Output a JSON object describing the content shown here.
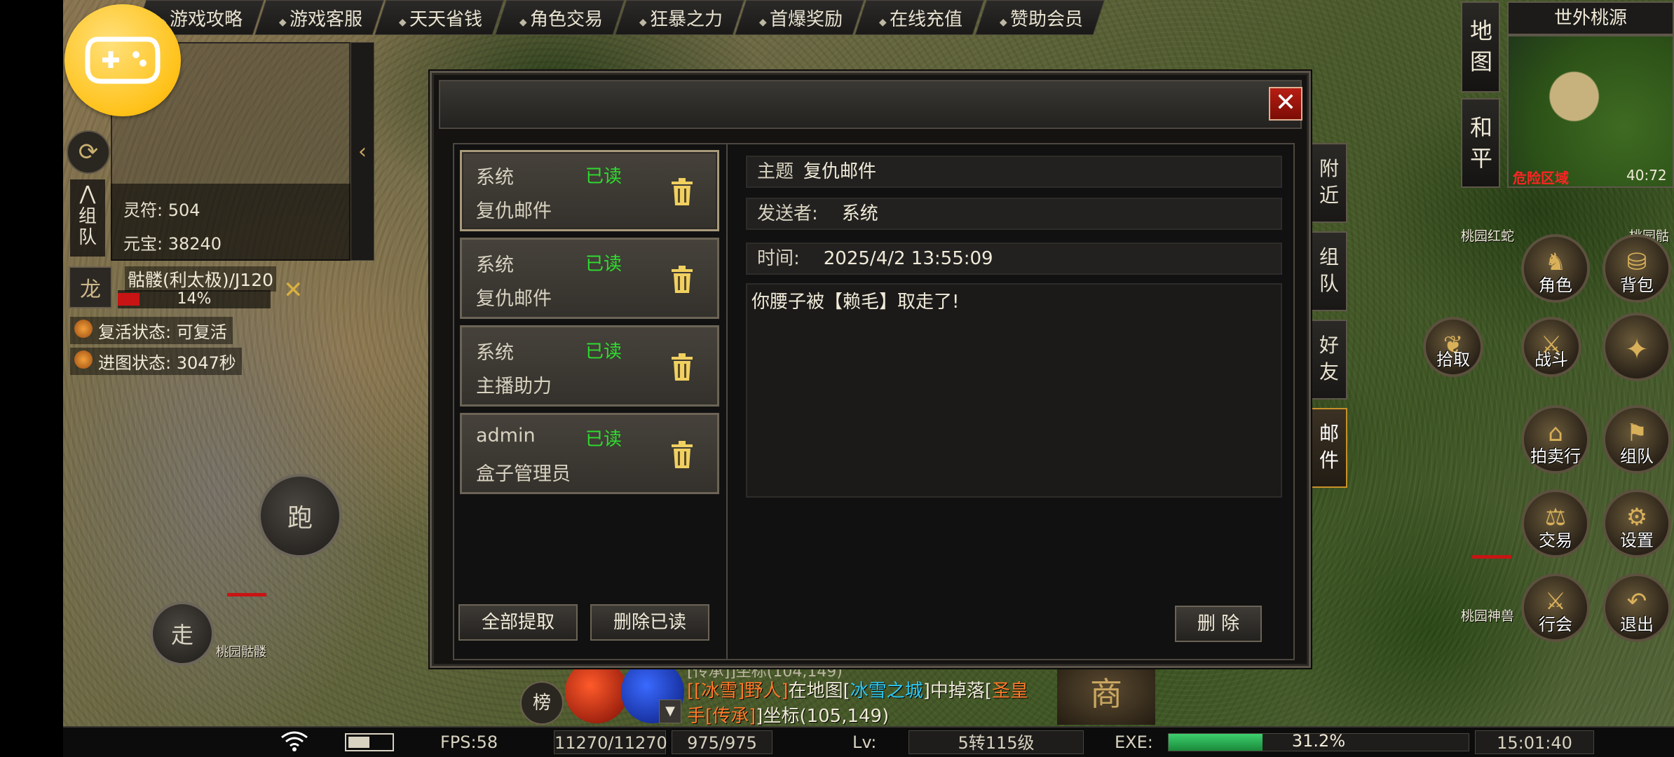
{
  "top_tabs": [
    "游戏攻略",
    "游戏客服",
    "天天省钱",
    "角色交易",
    "狂暴之力",
    "首爆奖励",
    "在线充值",
    "赞助会员"
  ],
  "top_left": {
    "group_label": "组队",
    "stats": [
      {
        "label": "灵符",
        "value": "504"
      },
      {
        "label": "元宝",
        "value": "38240"
      }
    ]
  },
  "player": {
    "name": "骷髅(利太极)/J120",
    "hp_percent_text": "14%",
    "hp_fraction": 0.14
  },
  "status_lines": [
    {
      "label": "复活状态",
      "value": "可复活"
    },
    {
      "label": "进图状态",
      "value": "3047秒"
    }
  ],
  "buttons": {
    "run": "跑",
    "walk": "走"
  },
  "mob_labels": {
    "skeleton": "桃园骷髅",
    "red_snake": "桃园红蛇",
    "skeleton_right": "桃园骷",
    "beast": "桃园神兽"
  },
  "minimap": {
    "map_btn": "地图",
    "peace_btn": "和平",
    "title": "世外桃源",
    "danger": "危险区域",
    "coords": "40:72"
  },
  "skills": [
    "角色",
    "背包",
    "拾取",
    "战斗",
    "拍卖行",
    "组队",
    "交易",
    "设置",
    "行会",
    "退出"
  ],
  "side_tabs": [
    "附近",
    "组队",
    "好友",
    "邮件"
  ],
  "mail_dialog": {
    "mails": [
      {
        "sender": "系统",
        "status": "已读",
        "subject": "复仇邮件"
      },
      {
        "sender": "系统",
        "status": "已读",
        "subject": "复仇邮件"
      },
      {
        "sender": "系统",
        "status": "已读",
        "subject": "主播助力"
      },
      {
        "sender": "admin",
        "status": "已读",
        "subject": "盒子管理员"
      }
    ],
    "collect_all": "全部提取",
    "delete_read": "删除已读",
    "subject_label": "主题",
    "subject_value": "复仇邮件",
    "sender_label": "发送者:",
    "sender_value": "系统",
    "time_label": "时间:",
    "time_value": "2025/4/2 13:55:09",
    "content": "你腰子被【赖毛】取走了!",
    "delete": "删 除",
    "close": "✕"
  },
  "chat": {
    "rank_btn": "榜",
    "top_partial": "[传承]]坐标(104,149)",
    "line1_pre": "[[冰雪]野人]",
    "line1_mid": "在地图[",
    "line1_map": "冰雪之城",
    "line1_post": "]中掉落[",
    "line1_item": "圣皇",
    "line2_item": "手[传承]",
    "line2_post": "]坐标(105,149)",
    "shop_glyph": "商"
  },
  "status_bar": {
    "fps": "FPS:58",
    "hp": "11270/11270",
    "mp": "975/975",
    "lv_label": "Lv:",
    "lv_value": "5转115级",
    "exe_label": "EXE:",
    "exe_percent_text": "31.2%",
    "exe_fraction": 0.312,
    "time": "15:01:40"
  },
  "colors": {
    "read_status": "#2fdc2f",
    "close_button": "#b71d12",
    "hp_fill": "#c81414",
    "exp_fill": "#3ecf6e",
    "danger_text": "#ff2424"
  }
}
